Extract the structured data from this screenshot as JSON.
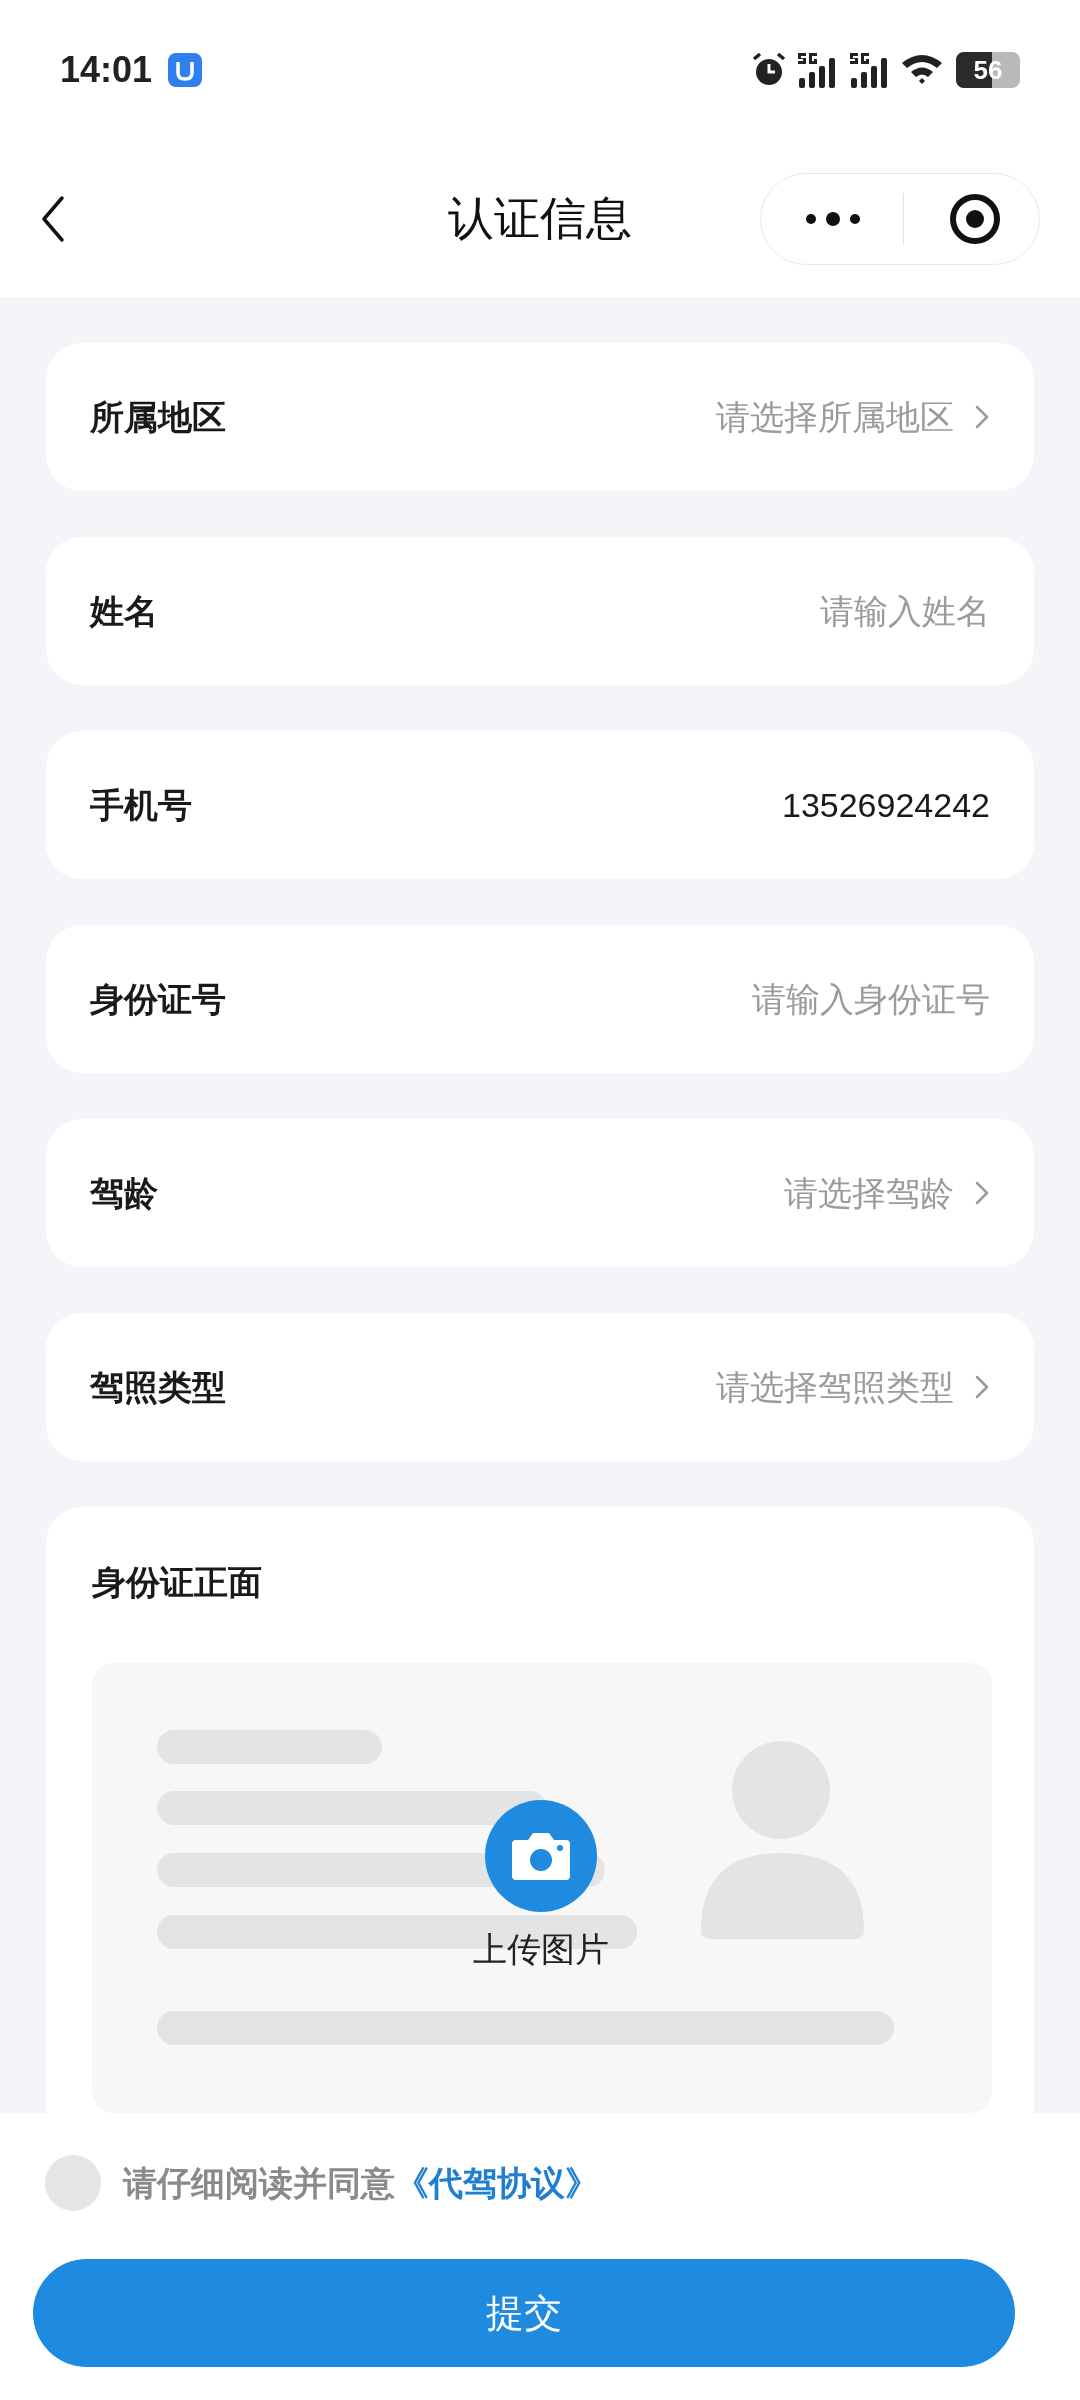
{
  "status_bar": {
    "time": "14:01",
    "battery": "56"
  },
  "nav": {
    "title": "认证信息"
  },
  "fields": [
    {
      "label": "所属地区",
      "kind": "select",
      "placeholder": "请选择所属地区"
    },
    {
      "label": "姓名",
      "kind": "input",
      "placeholder": "请输入姓名"
    },
    {
      "label": "手机号",
      "kind": "input",
      "value": "13526924242"
    },
    {
      "label": "身份证号",
      "kind": "input",
      "placeholder": "请输入身份证号"
    },
    {
      "label": "驾龄",
      "kind": "select",
      "placeholder": "请选择驾龄"
    },
    {
      "label": "驾照类型",
      "kind": "select",
      "placeholder": "请选择驾照类型"
    }
  ],
  "upload": {
    "title": "身份证正面",
    "button": "上传图片"
  },
  "agreement": {
    "checked": false,
    "text": "请仔细阅读并同意",
    "link": "《代驾协议》"
  },
  "submit": "提交"
}
